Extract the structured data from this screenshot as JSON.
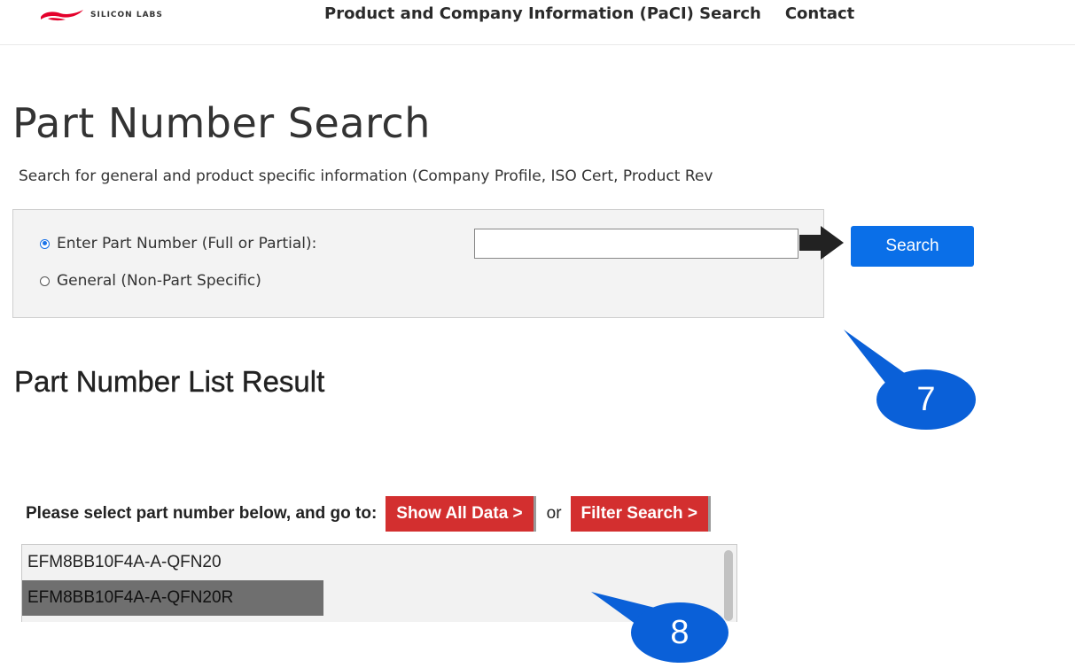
{
  "header": {
    "logo_text": "SILICON LABS",
    "nav": [
      {
        "label": "Product and Company Information (PaCI) Search"
      },
      {
        "label": "Contact"
      }
    ]
  },
  "page": {
    "title": "Part Number Search",
    "subtitle": "Search for general and product specific information (Company Profile, ISO Cert, Product Rev"
  },
  "search": {
    "option_part_label": "Enter Part Number (Full or Partial):",
    "option_part_selected": true,
    "option_general_label": "General (Non-Part Specific)",
    "option_general_selected": false,
    "input_value": "",
    "button_label": "Search"
  },
  "results": {
    "title": "Part Number List Result",
    "goto_label": "Please select part number below, and go to:",
    "show_all_label": "Show All Data >",
    "or_label": "or",
    "filter_label": "Filter Search >",
    "parts": [
      {
        "label": "EFM8BB10F4A-A-QFN20",
        "selected": false
      },
      {
        "label": "EFM8BB10F4A-A-QFN20R",
        "selected": true
      }
    ]
  },
  "annotations": [
    {
      "label": "7"
    },
    {
      "label": "8"
    }
  ],
  "colors": {
    "brand_red": "#e4002b",
    "search_button": "#0a6fe8",
    "action_red": "#d32f2f",
    "callout_blue": "#0a60d8"
  },
  "icons": [
    "silicon-labs-logo-icon",
    "arrow-right-icon"
  ]
}
